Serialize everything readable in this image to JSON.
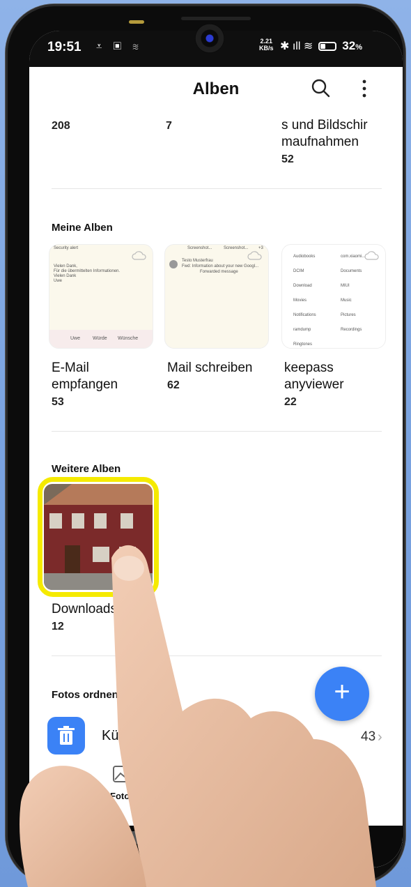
{
  "status_bar": {
    "time": "19:51",
    "left_icons": "⩡ ▣ ≋",
    "rate_value": "2.21",
    "rate_unit": "KB/s",
    "right_icons": "✱ ıll ≋",
    "battery": "32",
    "battery_unit": "%"
  },
  "header": {
    "title": "Alben"
  },
  "top_row": {
    "items": [
      {
        "label": "",
        "count": "208"
      },
      {
        "label": "",
        "count": "7"
      },
      {
        "label": "s und Bildschir maufnahmen",
        "count": "52"
      }
    ]
  },
  "meine_alben": {
    "heading": "Meine Alben",
    "albums": [
      {
        "label": "E-Mail empfangen",
        "count": "53",
        "thumb_lines": [
          "Security alert",
          "Vielen Dank,",
          "Für die übermittelten Informationen.",
          "Vielen Dank",
          "Uwe",
          "Uwe",
          "Würde",
          "Wünsche"
        ]
      },
      {
        "label": "Mail schreiben",
        "count": "62",
        "thumb_lines": [
          "Screenshot...",
          "Screenshot...",
          "+3",
          "Testo Musterfrau",
          "Fwd: Information about your new Googl...",
          "Forwarded message"
        ]
      },
      {
        "label": "keepass anyviewer",
        "count": "22",
        "thumb_lines": [
          "Audiobooks",
          "com.xiaomi...",
          "DCIM",
          "Documents",
          "Download",
          "MIUI",
          "Movies",
          "Music",
          "Notifications",
          "Pictures",
          "ramdump",
          "Recordings",
          "Ringtones"
        ]
      }
    ]
  },
  "weitere_alben": {
    "heading": "Weitere Alben",
    "albums": [
      {
        "label": "Downloads",
        "count": "12"
      }
    ]
  },
  "fotos_ordnen": {
    "heading": "Fotos ordnen",
    "item_label": "Kürzlic",
    "item_count": "43",
    "chevron": "›"
  },
  "fab_label": "+",
  "bottom_nav": {
    "photos_label": "Fotos"
  },
  "colors": {
    "accent": "#3b82f6",
    "highlight": "#f5ea00"
  }
}
